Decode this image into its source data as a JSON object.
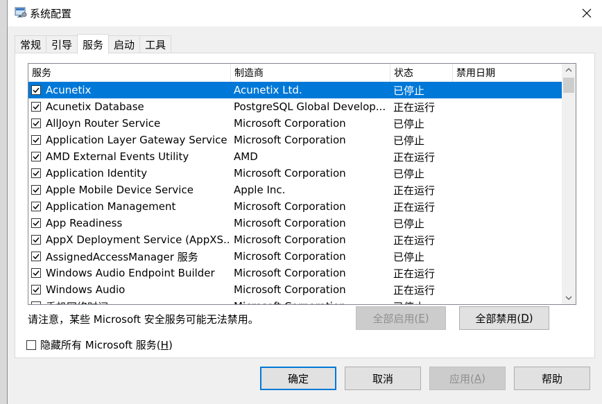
{
  "window": {
    "title": "系统配置",
    "icon": "msconfig-icon"
  },
  "tabs": [
    {
      "label": "常规",
      "active": false
    },
    {
      "label": "引导",
      "active": false
    },
    {
      "label": "服务",
      "active": true
    },
    {
      "label": "启动",
      "active": false
    },
    {
      "label": "工具",
      "active": false
    }
  ],
  "list": {
    "columns": [
      "服务",
      "制造商",
      "状态",
      "禁用日期"
    ],
    "rows": [
      {
        "name": "Acunetix",
        "maker": "Acunetix Ltd.",
        "status": "已停止",
        "date": "",
        "checked": true,
        "selected": true
      },
      {
        "name": "Acunetix Database",
        "maker": "PostgreSQL Global Develop...",
        "status": "正在运行",
        "date": "",
        "checked": true
      },
      {
        "name": "AllJoyn Router Service",
        "maker": "Microsoft Corporation",
        "status": "已停止",
        "date": "",
        "checked": true
      },
      {
        "name": "Application Layer Gateway Service",
        "maker": "Microsoft Corporation",
        "status": "已停止",
        "date": "",
        "checked": true
      },
      {
        "name": "AMD External Events Utility",
        "maker": "AMD",
        "status": "正在运行",
        "date": "",
        "checked": true
      },
      {
        "name": "Application Identity",
        "maker": "Microsoft Corporation",
        "status": "已停止",
        "date": "",
        "checked": true
      },
      {
        "name": "Apple Mobile Device Service",
        "maker": "Apple Inc.",
        "status": "正在运行",
        "date": "",
        "checked": true
      },
      {
        "name": "Application Management",
        "maker": "Microsoft Corporation",
        "status": "正在运行",
        "date": "",
        "checked": true
      },
      {
        "name": "App Readiness",
        "maker": "Microsoft Corporation",
        "status": "已停止",
        "date": "",
        "checked": true
      },
      {
        "name": "AppX Deployment Service (AppXS...",
        "maker": "Microsoft Corporation",
        "status": "正在运行",
        "date": "",
        "checked": true
      },
      {
        "name": "AssignedAccessManager 服务",
        "maker": "Microsoft Corporation",
        "status": "已停止",
        "date": "",
        "checked": true
      },
      {
        "name": "Windows Audio Endpoint Builder",
        "maker": "Microsoft Corporation",
        "status": "正在运行",
        "date": "",
        "checked": true
      },
      {
        "name": "Windows Audio",
        "maker": "Microsoft Corporation",
        "status": "正在运行",
        "date": "",
        "checked": true
      },
      {
        "name": "手机网络时间",
        "maker": "Microsoft Corporation",
        "status": "已停止",
        "date": "",
        "checked": true
      }
    ]
  },
  "notice": "请注意，某些 Microsoft 安全服务可能无法禁用。",
  "buttons": {
    "enable_all": {
      "text": "全部启用(",
      "key": "E",
      "end": ")"
    },
    "disable_all": {
      "text": "全部禁用(",
      "key": "D",
      "end": ")"
    },
    "ok": "确定",
    "cancel": "取消",
    "apply": {
      "text": "应用(",
      "key": "A",
      "end": ")"
    },
    "help": "帮助"
  },
  "hide_ms": {
    "text": "隐藏所有 Microsoft 服务(",
    "key": "H",
    "end": ")",
    "checked": false
  },
  "colors": {
    "selection": "#0078d7",
    "window_bg": "#f0f0f0"
  }
}
